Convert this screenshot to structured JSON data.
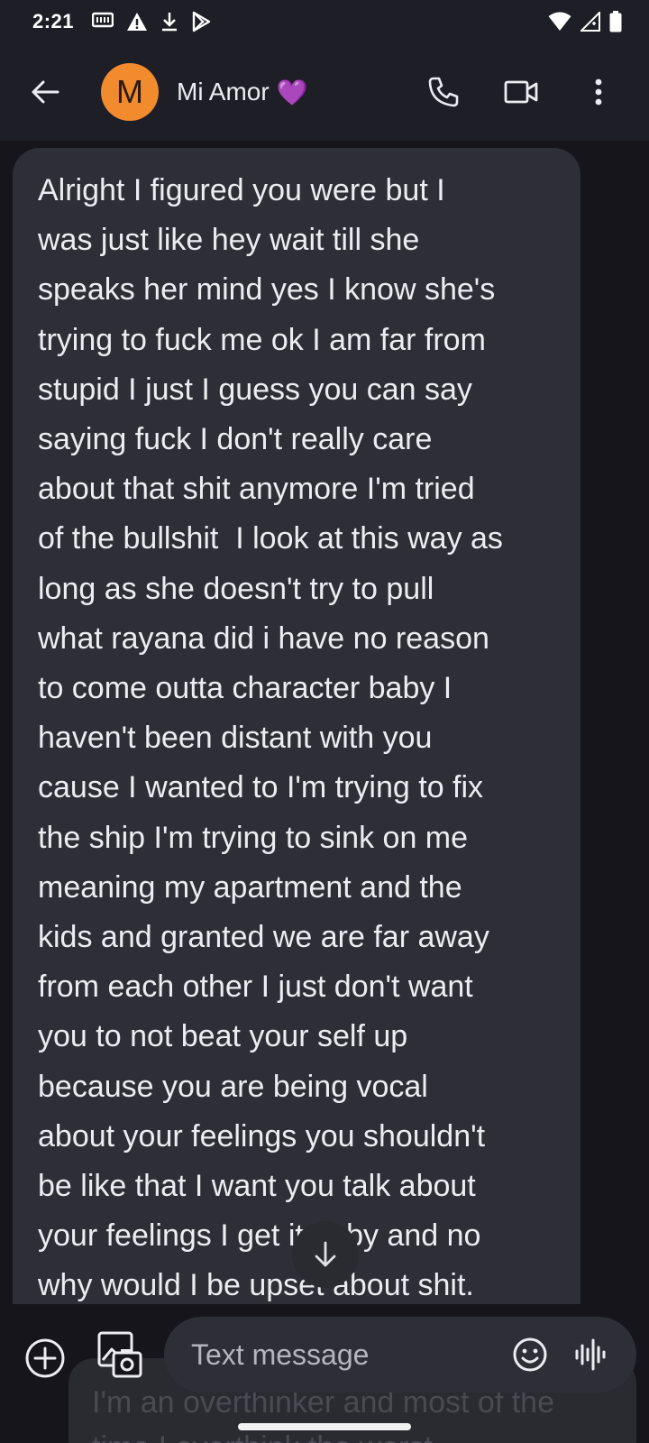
{
  "status_bar": {
    "time": "2:21",
    "left_icons": [
      "messages-notification-icon",
      "warning-icon",
      "download-icon",
      "play-store-icon"
    ],
    "right_icons": [
      "wifi-icon",
      "cell-signal-icon",
      "battery-icon"
    ]
  },
  "app_bar": {
    "avatar_initial": "M",
    "contact_name": "Mi Amor",
    "contact_emoji": "💜"
  },
  "message": {
    "text": "Alright I figured you were but I\nwas just like hey wait till she\nspeaks her mind yes I know she's\ntrying to fuck me ok I am far from\nstupid I just I guess you can say\nsaying fuck I don't really care\nabout that shit anymore I'm tried\nof the bullshit  I look at this way as\nlong as she doesn't try to pull\nwhat rayana did i have no reason\nto come outta character baby I\nhaven't been distant with you\ncause I wanted to I'm trying to fix\nthe ship I'm trying to sink on me\nmeaning my apartment and the\nkids and granted we are far away\nfrom each other I just don't want\nyou to not beat your self up\nbecause you are being vocal\nabout your feelings you shouldn't\nbe like that I want you talk about\nyour feelings I get it baby and no\nwhy would I be upset about shit."
  },
  "compose": {
    "placeholder": "Text message",
    "ghost_text": "I'm an overthinker and most of the\ntime I overthink the worst"
  },
  "colors": {
    "avatar": "#f28a2e",
    "heart": "#9b5de5",
    "bubble": "#2e2e36",
    "app_bar": "#1e1e26"
  }
}
